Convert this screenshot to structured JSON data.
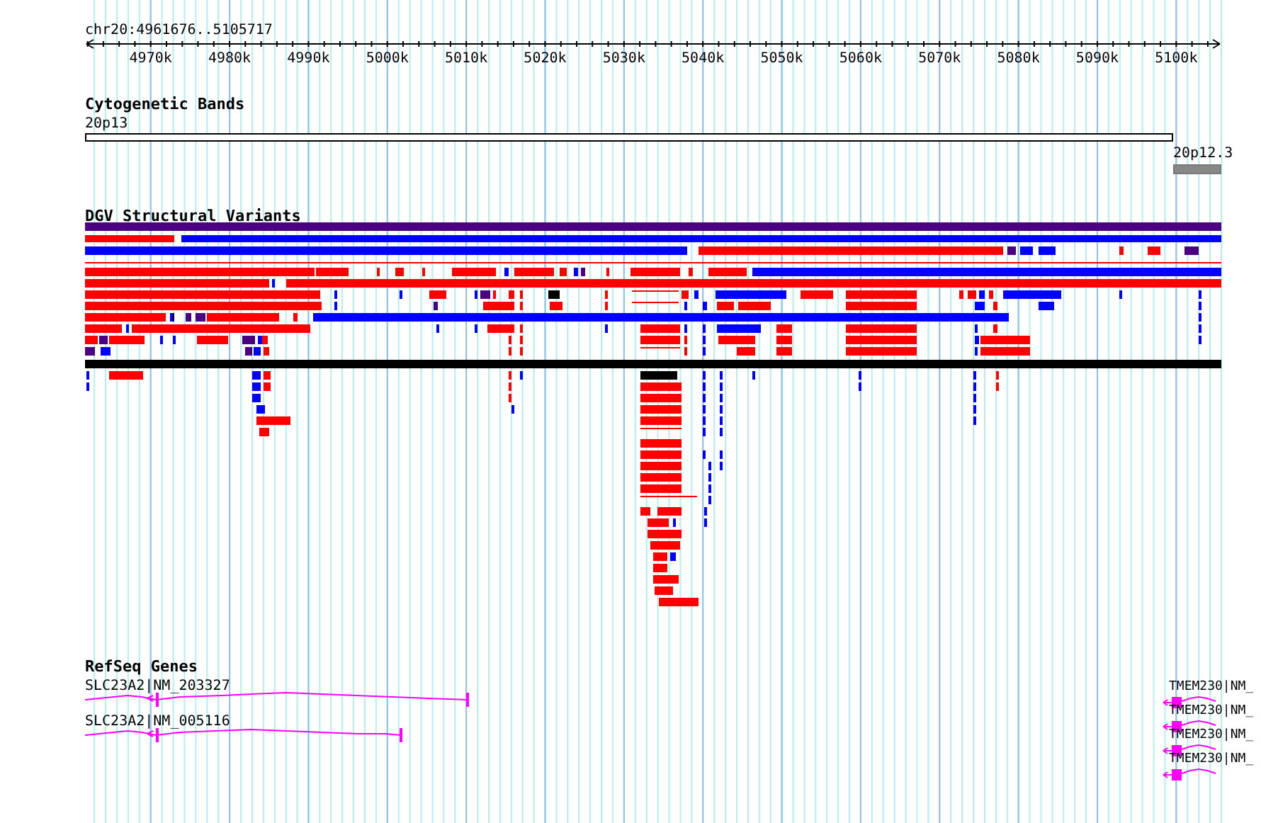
{
  "ruler": {
    "region": "chr20:4961676..5105717",
    "ticks": [
      "4970k",
      "4980k",
      "4990k",
      "5000k",
      "5010k",
      "5020k",
      "5030k",
      "5040k",
      "5050k",
      "5060k",
      "5070k",
      "5080k",
      "5090k",
      "5100k"
    ]
  },
  "cytogenetic_bands": {
    "title": "Cytogenetic Bands",
    "bands": [
      {
        "label": "20p13",
        "kind": "clear"
      },
      {
        "label": "20p12.3",
        "kind": "stained"
      }
    ]
  },
  "dgv_structural_variants": {
    "title": "DGV Structural Variants"
  },
  "refseq_genes": {
    "title": "RefSeq Genes",
    "genes": [
      {
        "label": "SLC23A2|NM_203327",
        "kind": "long"
      },
      {
        "label": "SLC23A2|NM_005116",
        "kind": "short"
      },
      {
        "label": "TMEM230|NM_",
        "kind": "edge"
      },
      {
        "label": "TMEM230|NM_",
        "kind": "edge"
      },
      {
        "label": "TMEM230|NM_",
        "kind": "edge"
      },
      {
        "label": "TMEM230|NM_",
        "kind": "edge"
      }
    ]
  }
}
